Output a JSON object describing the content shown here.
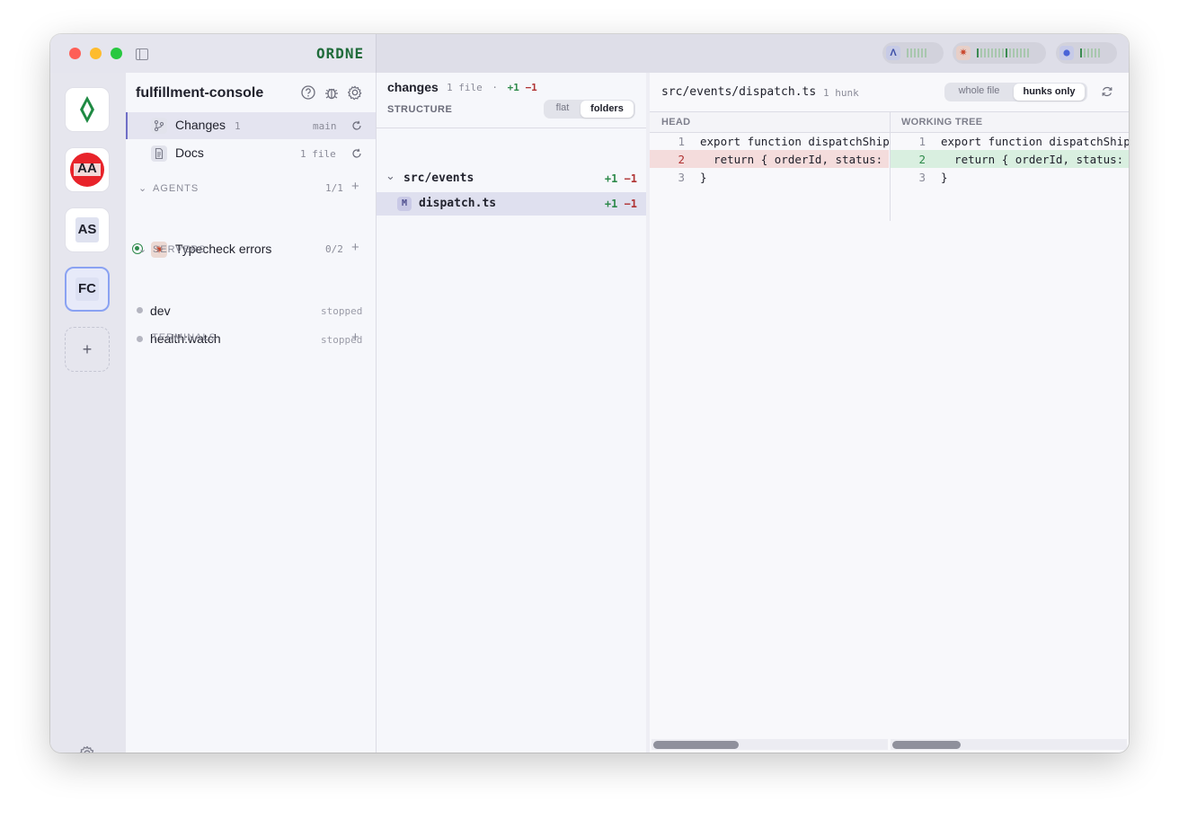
{
  "app": {
    "logo": "ORDNE"
  },
  "titlebar": {
    "activity_pills": [
      {
        "icon": "lambda-icon"
      },
      {
        "icon": "starburst-icon"
      },
      {
        "icon": "dot-icon"
      }
    ]
  },
  "rail": {
    "workspaces": [
      {
        "label": "",
        "icon": "green-diamond-icon"
      },
      {
        "label": "AA"
      },
      {
        "label": "AS"
      },
      {
        "label": "FC",
        "active": true
      }
    ],
    "add_label": "+"
  },
  "sidebar": {
    "project_title": "fulfillment-console",
    "items": [
      {
        "label": "Changes",
        "count": "1",
        "meta": "main"
      },
      {
        "label": "Docs",
        "meta": "1 file"
      }
    ],
    "agents": {
      "title": "AGENTS",
      "count": "1/1",
      "items": [
        {
          "label": "Typecheck errors"
        }
      ]
    },
    "servers": {
      "title": "SERVERS",
      "count": "0/2",
      "items": [
        {
          "label": "dev",
          "status": "stopped"
        },
        {
          "label": "health:watch",
          "status": "stopped"
        }
      ]
    },
    "terminals": {
      "title": "TERMINALS"
    }
  },
  "changes": {
    "title": "changes",
    "summary": "1 file",
    "dot": "·",
    "added": "+1",
    "removed": "−1",
    "structure_label": "STRUCTURE",
    "view_options": [
      "flat",
      "folders"
    ],
    "view_selected": "folders",
    "folder": {
      "name": "src/events",
      "added": "+1",
      "removed": "−1"
    },
    "file": {
      "badge": "M",
      "name": "dispatch.ts",
      "added": "+1",
      "removed": "−1"
    }
  },
  "diff": {
    "path": "src/events/dispatch.ts",
    "hunks": "1 hunk",
    "mode_options": [
      "whole file",
      "hunks only"
    ],
    "mode_selected": "hunks only",
    "left_header": "HEAD",
    "right_header": "WORKING TREE",
    "left_lines": [
      {
        "n": "1",
        "code": "export function dispatchShipment",
        "kind": "ctx"
      },
      {
        "n": "2",
        "code": "  return { orderId, status: ",
        "kind": "del"
      },
      {
        "n": "3",
        "code": "}",
        "kind": "ctx"
      }
    ],
    "right_lines": [
      {
        "n": "1",
        "code": "export function dispatchShipment",
        "kind": "ctx"
      },
      {
        "n": "2",
        "code": "  return { orderId, status: ",
        "kind": "add"
      },
      {
        "n": "3",
        "code": "}",
        "kind": "ctx"
      }
    ]
  },
  "colors": {
    "accent": "#8aa2f2",
    "added": "#2e8a4b",
    "removed": "#b03333",
    "brand": "#1f6b3a"
  }
}
